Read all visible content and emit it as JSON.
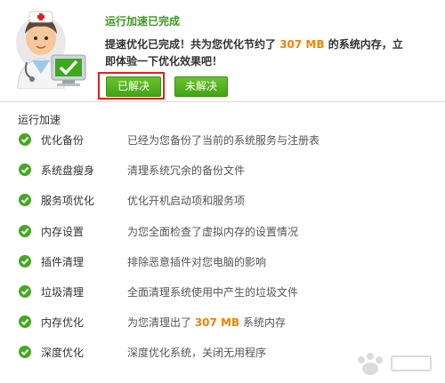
{
  "header": {
    "title": "运行加速已完成",
    "message_pre": "提速优化已完成！共为您优化节约了 ",
    "message_amount": "307 MB",
    "message_post": " 的系统内存，立即体验一下优化效果吧！",
    "solved_button": "已解决",
    "unsolved_button": "未解决"
  },
  "section": {
    "title": "运行加速"
  },
  "items": [
    {
      "name": "优化备份",
      "desc": "已经为您备份了当前的系统服务与注册表"
    },
    {
      "name": "系统盘瘦身",
      "desc": "清理系统冗余的备份文件"
    },
    {
      "name": "服务项优化",
      "desc": "优化开机启动项和服务项"
    },
    {
      "name": "内存设置",
      "desc": "为您全面检查了虚拟内存的设置情况"
    },
    {
      "name": "插件清理",
      "desc": "排除恶意插件对您电脑的影响"
    },
    {
      "name": "垃圾清理",
      "desc": "全面清理系统使用中产生的垃圾文件"
    },
    {
      "name": "内存优化",
      "desc_pre": "为您清理出了 ",
      "desc_amount": "307 MB",
      "desc_post": " 系统内存"
    },
    {
      "name": "深度优化",
      "desc": "深度优化系统，关闭无用程序"
    }
  ],
  "colors": {
    "accent_green": "#44a91f",
    "highlight_orange": "#f08300",
    "annotation_red": "#e41f1f"
  },
  "icons": {
    "status": "check-circle-icon",
    "mascot": "doctor-computer-icon"
  }
}
